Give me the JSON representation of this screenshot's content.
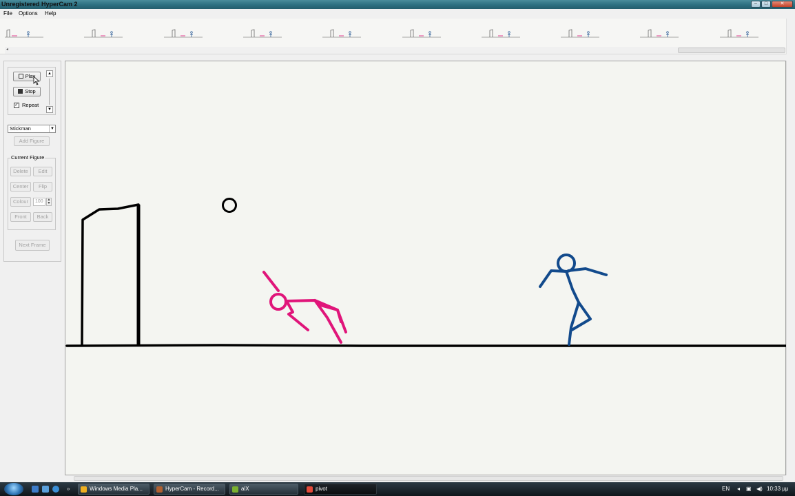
{
  "window": {
    "title": "Unregistered HyperCam 2",
    "buttons": [
      "minimize",
      "maximize",
      "close"
    ]
  },
  "menu": [
    "File",
    "Options",
    "Help"
  ],
  "filmstrip": {
    "frame_count": 10
  },
  "controls": {
    "play_label": "Play",
    "stop_label": "Stop",
    "repeat_label": "Repeat",
    "repeat_checked": true,
    "figure_select": "Stickman",
    "add_figure_label": "Add Figure",
    "current_figure_title": "Current Figure",
    "delete_label": "Delete",
    "edit_label": "Edit",
    "center_label": "Center",
    "flip_label": "Flip",
    "colour_label": "Colour",
    "opacity_value": "100",
    "front_label": "Front",
    "back_label": "Back",
    "next_frame_label": "Next Frame"
  },
  "scene": {
    "ground_color": "#000000",
    "pink_figure_color": "#e0157a",
    "blue_figure_color": "#124a8c",
    "ball_color": "#000000",
    "goal_color": "#000000"
  },
  "taskbar": {
    "tasks": [
      {
        "label": "Windows Media Pla...",
        "active": false,
        "icon_color": "#f0b020"
      },
      {
        "label": "HyperCam - Record...",
        "active": false,
        "icon_color": "#b06030"
      },
      {
        "label": "alX",
        "active": false,
        "icon_color": "#7ab030"
      },
      {
        "label": "pivot",
        "active": true,
        "icon_color": "#e44a3a"
      }
    ],
    "language": "EN",
    "clock": "10:33 μμ"
  }
}
